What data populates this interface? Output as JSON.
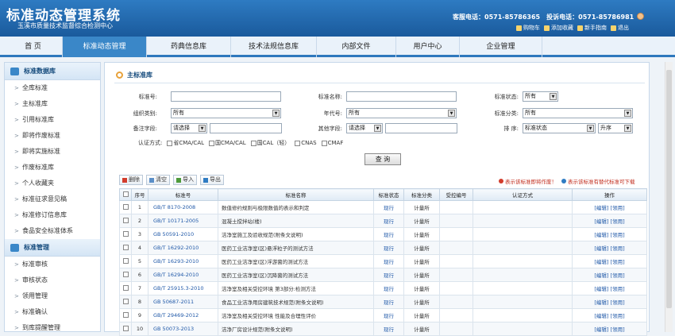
{
  "header": {
    "title": "标准动态管理系统",
    "subtitle": "玉溪市质量技术监督综合检测中心",
    "service_phone": "客服电话：0571-85786365",
    "complaint_phone": "投诉电话：0571-85786981",
    "links": [
      "购物车",
      "添加收藏",
      "新手指南",
      "退出"
    ]
  },
  "nav": {
    "tabs": [
      "首 页",
      "标准动态管理",
      "药典信息库",
      "技术法规信息库",
      "内部文件",
      "用户中心",
      "企业管理"
    ],
    "active": "标准动态管理"
  },
  "sidebar": {
    "section1_title": "标准数据库",
    "section1_items": [
      "全库标准",
      "主标准库",
      "引用标准库",
      "即将作废标准",
      "即将实施标准",
      "作废标准库",
      "个人收藏夹",
      "标准征求意见稿",
      "标准修订信息库",
      "食品安全标准体系"
    ],
    "section2_title": "标准管理",
    "section2_items": [
      "标准审核",
      "审核状态",
      "领用管理",
      "标准确认",
      "到库提醒管理"
    ]
  },
  "panel": {
    "title": "主标准库",
    "form": {
      "std_no_label": "标准号:",
      "std_name_label": "标准名称:",
      "std_state_label": "标准状态:",
      "std_state_value": "所有",
      "org_label": "组织类别:",
      "org_value": "所有",
      "year_label": "年代号:",
      "year_value": "所有",
      "category_label": "标准分类:",
      "category_value": "所有",
      "remark_label": "备注字段:",
      "remark_value": "请选择",
      "other_label": "其他字段:",
      "other_value": "请选择",
      "sort_label": "排 序:",
      "sort_value": "标准状态",
      "sort_dir": "升序",
      "cert_label": "认证方式:",
      "certs": [
        "省CMA/CAL",
        "国CMA/CAL",
        "国CAL（轻）",
        "CNAS",
        "CMAF"
      ],
      "query_button": "查 询"
    },
    "toolbar": [
      "删除",
      "清空",
      "导入",
      "导出"
    ],
    "legend": [
      "表示该标准即将作废！",
      "表示该标准有替代标准可下载"
    ],
    "columns": [
      "",
      "序号",
      "标准号",
      "标准名称",
      "标准状态",
      "标准分类",
      "受控编号",
      "认证方式",
      "操作"
    ],
    "rows": [
      {
        "no": "1",
        "code": "GB/T 8170-2008",
        "name": "数值修约规则与极限数值的表示和判定",
        "state": "现行",
        "cat": "计量所",
        "op": "[编辑] [领用]"
      },
      {
        "no": "2",
        "code": "GB/T 10171-2005",
        "name": "混凝土搅拌站(楼)",
        "state": "现行",
        "cat": "计量所",
        "op": "[编辑] [领用]"
      },
      {
        "no": "3",
        "code": "GB 50591-2010",
        "name": "洁净室施工及验收规范(附条文说明)",
        "state": "现行",
        "cat": "计量所",
        "op": "[编辑] [领用]"
      },
      {
        "no": "4",
        "code": "GB/T 16292-2010",
        "name": "医药工业洁净室(区)悬浮粒子的测试方法",
        "state": "现行",
        "cat": "计量所",
        "op": "[编辑] [领用]"
      },
      {
        "no": "5",
        "code": "GB/T 16293-2010",
        "name": "医药工业洁净室(区)浮游菌的测试方法",
        "state": "现行",
        "cat": "计量所",
        "op": "[编辑] [领用]"
      },
      {
        "no": "6",
        "code": "GB/T 16294-2010",
        "name": "医药工业洁净室(区)沉降菌的测试方法",
        "state": "现行",
        "cat": "计量所",
        "op": "[编辑] [领用]"
      },
      {
        "no": "7",
        "code": "GB/T 25915.3-2010",
        "name": "洁净室及相关受控环境 第3部分:检测方法",
        "state": "现行",
        "cat": "计量所",
        "op": "[编辑] [领用]"
      },
      {
        "no": "8",
        "code": "GB 50687-2011",
        "name": "食品工业洁净用房建筑技术规范(附条文说明)",
        "state": "现行",
        "cat": "计量所",
        "op": "[编辑] [领用]"
      },
      {
        "no": "9",
        "code": "GB/T 29469-2012",
        "name": "洁净室及相关受控环境 性能及合理性评价",
        "state": "现行",
        "cat": "计量所",
        "op": "[编辑] [领用]"
      },
      {
        "no": "10",
        "code": "GB 50073-2013",
        "name": "洁净厂房设计规范(附条文说明)",
        "state": "现行",
        "cat": "计量所",
        "op": "[编辑] [领用]"
      }
    ]
  }
}
